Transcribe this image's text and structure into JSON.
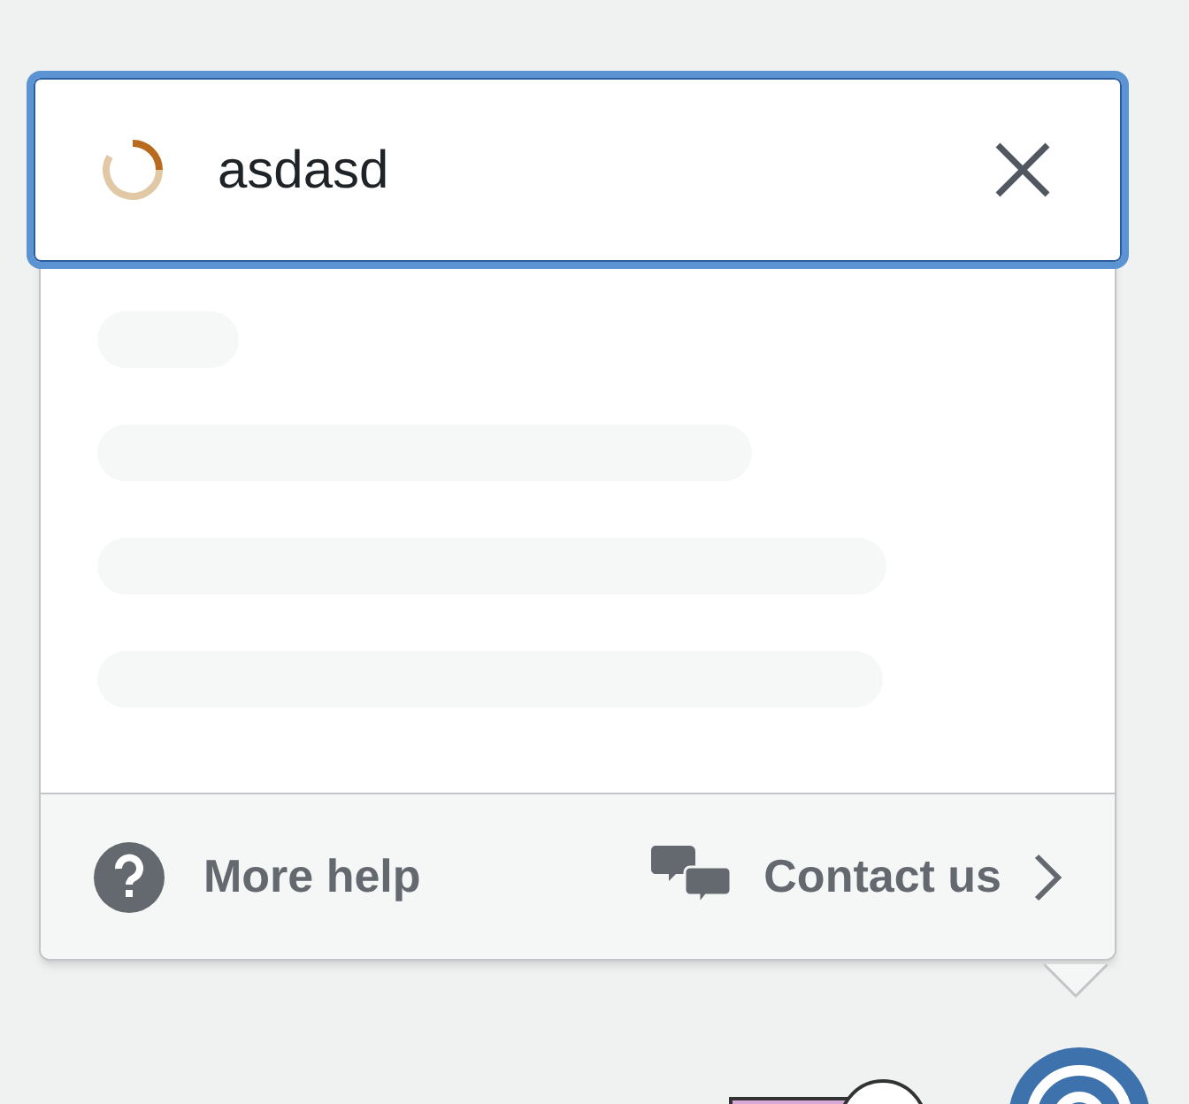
{
  "search": {
    "value": "asdasd",
    "loading": true
  },
  "footer": {
    "more_help": "More help",
    "contact": "Contact us"
  }
}
